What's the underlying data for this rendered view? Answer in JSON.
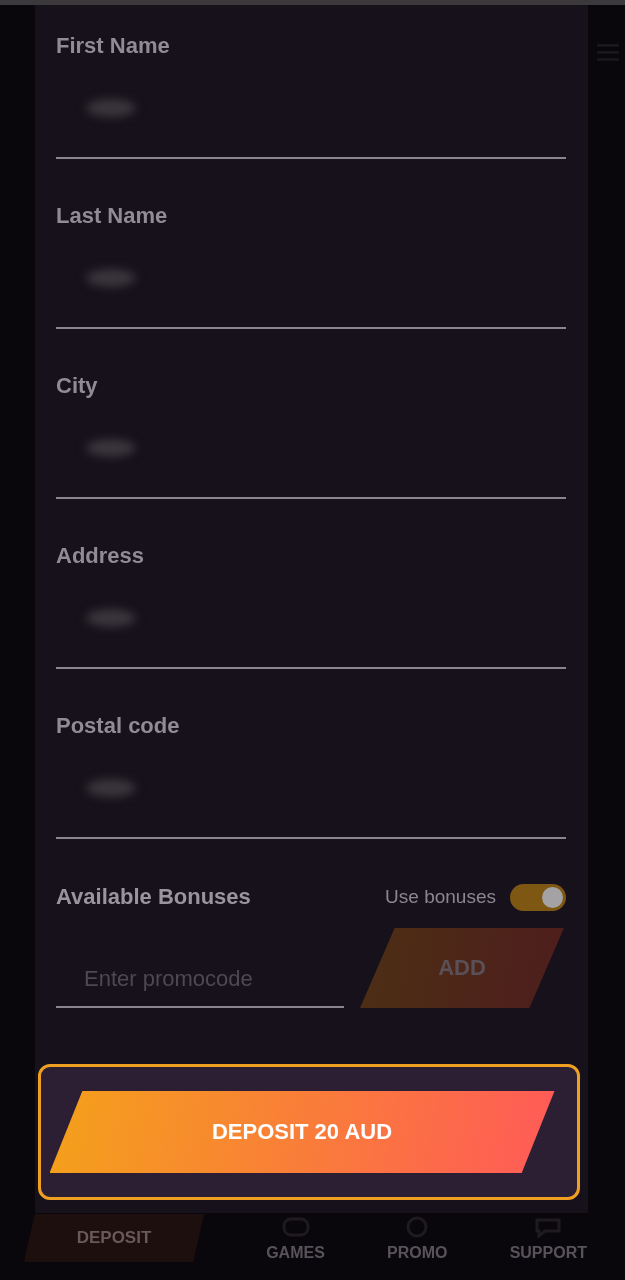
{
  "form": {
    "fields": [
      {
        "label": "First Name"
      },
      {
        "label": "Last Name"
      },
      {
        "label": "City"
      },
      {
        "label": "Address"
      },
      {
        "label": "Postal code"
      }
    ],
    "bonuses": {
      "title": "Available Bonuses",
      "toggle_label": "Use bonuses",
      "on": true
    },
    "promo": {
      "placeholder": "Enter promocode",
      "button": "ADD"
    },
    "submit": "DEPOSIT 20 AUD"
  },
  "bottom_nav": [
    {
      "kind": "deposit",
      "label": "DEPOSIT"
    },
    {
      "kind": "games",
      "label": "GAMES"
    },
    {
      "kind": "promo",
      "label": "PROMO"
    },
    {
      "kind": "support",
      "label": "SUPPORT"
    }
  ]
}
